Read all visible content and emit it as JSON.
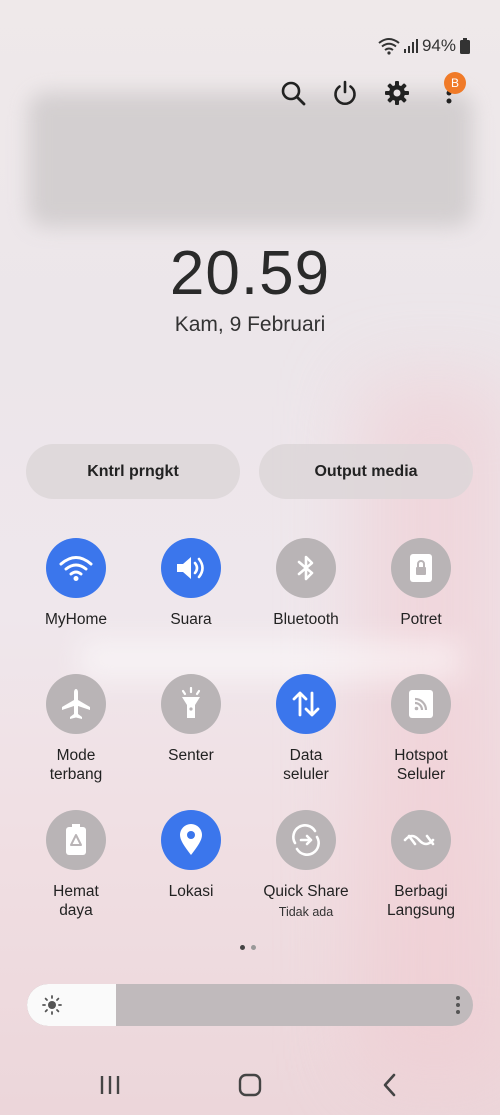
{
  "status": {
    "battery_text": "94%"
  },
  "clock": {
    "time": "20.59",
    "date": "Kam, 9 Februari"
  },
  "notification_badge": "B",
  "quick_buttons": {
    "device_control": "Kntrl prngkt",
    "media_output": "Output media"
  },
  "tiles": [
    {
      "label": "MyHome",
      "state": "on",
      "icon": "wifi-icon"
    },
    {
      "label": "Suara",
      "state": "on",
      "icon": "volume-icon"
    },
    {
      "label": "Bluetooth",
      "state": "off",
      "icon": "bluetooth-icon"
    },
    {
      "label": "Potret",
      "state": "off",
      "icon": "portrait-lock-icon"
    },
    {
      "label": "Mode\nterbang",
      "state": "off",
      "icon": "airplane-icon"
    },
    {
      "label": "Senter",
      "state": "off",
      "icon": "flashlight-icon"
    },
    {
      "label": "Data\nseluler",
      "state": "on",
      "icon": "mobile-data-icon"
    },
    {
      "label": "Hotspot\nSeluler",
      "state": "off",
      "icon": "hotspot-icon"
    },
    {
      "label": "Hemat\ndaya",
      "state": "off",
      "icon": "power-saving-icon"
    },
    {
      "label": "Lokasi",
      "state": "on",
      "icon": "location-icon"
    },
    {
      "label": "Quick Share",
      "sublabel": "Tidak ada",
      "state": "off",
      "icon": "quick-share-icon"
    },
    {
      "label": "Berbagi\nLangsung",
      "state": "off",
      "icon": "nearby-share-icon"
    }
  ],
  "brightness": {
    "level": 0.2
  },
  "colors": {
    "accent": "#3b76ec",
    "tile_off": "#b9b4b6",
    "badge": "#f07a28"
  }
}
